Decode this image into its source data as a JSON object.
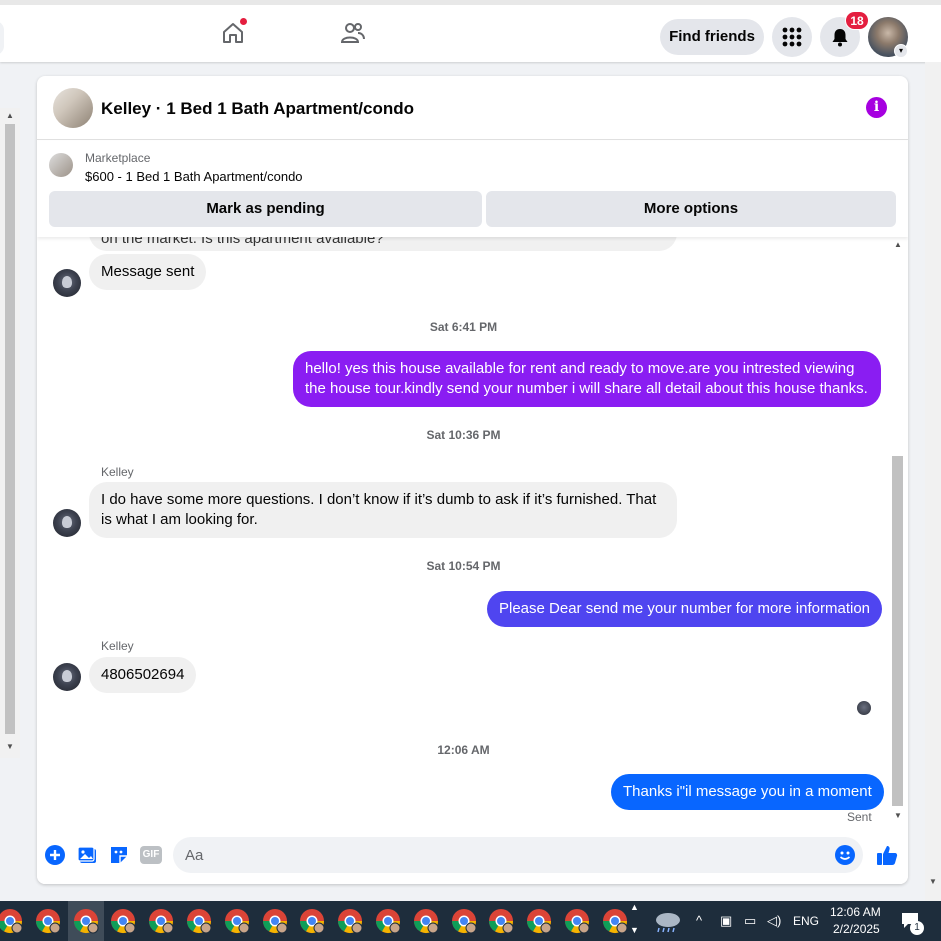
{
  "topbar": {
    "find_friends_label": "Find friends",
    "notification_count": "18",
    "icons": [
      "home-icon",
      "friends-icon",
      "apps-grid-icon",
      "bell-icon"
    ]
  },
  "conversation": {
    "title": "Kelley · 1 Bed 1 Bath Apartment/condo",
    "marketplace_label": "Marketplace",
    "listing": "$600 - 1 Bed 1 Bath Apartment/condo",
    "mark_pending_label": "Mark as pending",
    "more_options_label": "More options"
  },
  "messages": {
    "clipped_text": "on the market. Is this apartment available?",
    "m1": "Message sent",
    "ts1": "Sat 6:41 PM",
    "m2": "hello! yes this house available for rent and ready to move.are you intrested viewing the house tour.kindly send your number i will share all detail about this house thanks.",
    "ts2": "Sat 10:36 PM",
    "sender1": "Kelley",
    "m3": "I do have some more questions. I don’t know if it’s dumb to ask if it’s furnished. That is what I am looking for.",
    "ts3": "Sat 10:54 PM",
    "m4": "Please Dear send me your number for more information",
    "sender2": "Kelley",
    "m5": "4806502694",
    "ts4": "12:06 AM",
    "m6": "Thanks i\"il message you in a moment",
    "sent_status": "Sent"
  },
  "composer": {
    "placeholder": "Aa",
    "gif_label": "GIF"
  },
  "taskbar": {
    "language": "ENG",
    "time": "12:06 AM",
    "date": "2/2/2025",
    "notif_count": "1"
  },
  "colors": {
    "accent": "#0866ff",
    "purple_bubble": "#8a1df2",
    "blue_bubble": "#4f45f0",
    "info": "#a600e0"
  }
}
